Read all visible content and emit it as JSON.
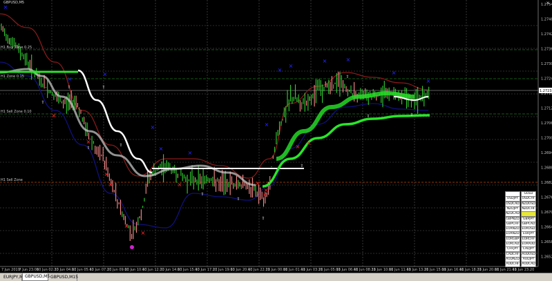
{
  "window": {
    "title": "GBPUSD,M5",
    "close_glyph": "×"
  },
  "tabs": [
    {
      "label": "EURJPY,M5",
      "active": false
    },
    {
      "label": "GBPUSD,M5",
      "active": true
    },
    {
      "label": "GBPUSD,M15",
      "active": false
    }
  ],
  "price_axis": {
    "labels": [
      "1.27545",
      "1.27485",
      "1.27425",
      "1.27365",
      "1.27305",
      "1.27245",
      "1.27185",
      "1.27125",
      "1.27065",
      "1.27005",
      "1.26945",
      "1.26885",
      "1.26825",
      "1.26765",
      "1.26705",
      "1.26645",
      "1.26585",
      "1.26525"
    ],
    "current_price": "1.27235"
  },
  "time_axis": {
    "labels": [
      "7 Jun 2019",
      "7 Jun 23:00",
      "10 Jun 02:20",
      "10 Jun 04:00",
      "10 Jun 05:40",
      "10 Jun 07:20",
      "10 Jun 09:00",
      "10 Jun 10:40",
      "10 Jun 12:20",
      "10 Jun 14:00",
      "10 Jun 15:40",
      "10 Jun 17:20",
      "10 Jun 19:00",
      "10 Jun 20:40",
      "10 Jun 22:20",
      "11 Jun 00:00",
      "11 Jun 01:40",
      "11 Jun 03:20",
      "11 Jun 05:00",
      "11 Jun 06:40",
      "11 Jun 08:20",
      "11 Jun 10:00",
      "11 Jun 11:40",
      "11 Jun 13:20",
      "11 Jun 15:00",
      "11 Jun 16:40",
      "11 Jun 18:20",
      "11 Jun 20:00",
      "11 Jun 21:40",
      "11 Jun 23:20"
    ]
  },
  "level_labels": [
    "H1 Buy Zone 0.25",
    "H1 Zone 0.15",
    "H1 Sell Zone 0.10",
    "H1 Sell Zone"
  ],
  "symbol_panel": [
    [
      "",
      "GOLD"
    ],
    [
      "USDJPY",
      "USDCHF"
    ],
    [
      "USDCAD",
      "NZDUSD"
    ],
    [
      "NZDJPY",
      "NZDCHF"
    ],
    [
      "NZDCAD",
      ""
    ],
    [
      "GBPNZD",
      "GBPJPY"
    ],
    [
      "GBPCHF",
      "GBPCAD"
    ],
    [
      "EURNZD",
      "EURUSD"
    ],
    [
      "EURNZD",
      "EURJPY"
    ],
    [
      "EURGBP",
      "EURCHF"
    ],
    [
      "EURCAD",
      "EURAUD"
    ],
    [
      "CHFJPY",
      "CADJPY"
    ],
    [
      "CADCHF",
      "AUDUSD"
    ],
    [
      "AUDNZD",
      "AUDJPY"
    ],
    [
      "AUDCHF",
      "AUDCAD"
    ]
  ],
  "colors": {
    "background": "#000000",
    "grid": "#5a5a5a",
    "candles_bull": "#32d232",
    "candles_bear": "#ff8c8c",
    "upper_band": "#8b1a1a",
    "lower_band": "#101080",
    "trend_up": "#28e628",
    "trend_flat": "#ffffff",
    "level_green": "#1a7a1a",
    "level_orange": "#c84800",
    "buy_marker": "#1e1ee6",
    "sell_marker": "#e61e1e",
    "panel_highlight": "#e8e838"
  }
}
